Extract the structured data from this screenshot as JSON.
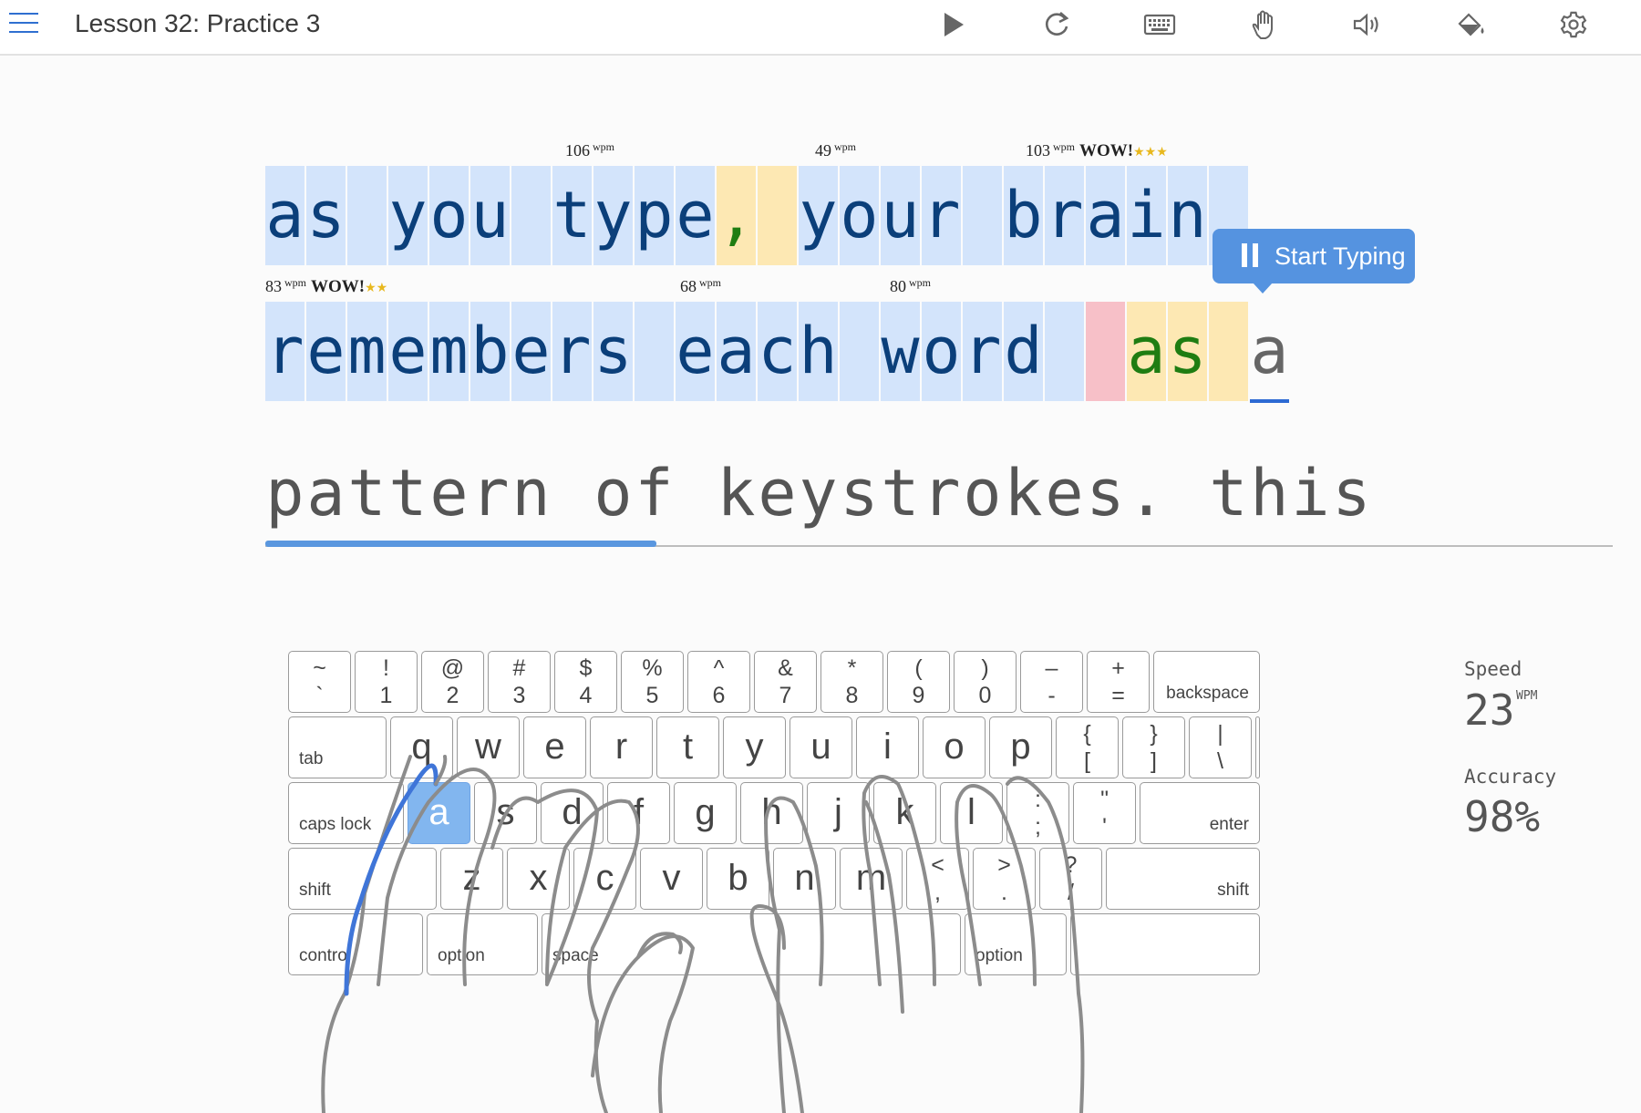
{
  "header": {
    "title": "Lesson 32: Practice 3",
    "tools": [
      "play-icon",
      "restart-icon",
      "keyboard-icon",
      "hand-icon",
      "sound-icon",
      "paint-bucket-icon",
      "gear-icon"
    ]
  },
  "typing": {
    "row1": "as you type, your brain ",
    "row2": "remembers each word as a",
    "row3": "pattern of keystrokes. this",
    "row1_status": "bbbbbbbbbbbyybbbbbbbbbbb",
    "row2_status": "bbbbbbbbbbbbbbbbbbbbppyc",
    "row1_correct_colored": "",
    "word_speeds": [
      {
        "wpm": "106",
        "unit": "wpm",
        "badge": "",
        "stars": ""
      },
      {
        "wpm": "49",
        "unit": "wpm",
        "badge": "",
        "stars": ""
      },
      {
        "wpm": "103",
        "unit": "wpm",
        "badge": "WOW!",
        "stars": "★★★"
      },
      {
        "wpm": "83",
        "unit": "wpm",
        "badge": "WOW!",
        "stars": "★★"
      },
      {
        "wpm": "68",
        "unit": "wpm",
        "badge": "",
        "stars": ""
      },
      {
        "wpm": "80",
        "unit": "wpm",
        "badge": "",
        "stars": ""
      }
    ],
    "lesson_progress": 0.29,
    "tooltip": "Start Typing"
  },
  "keyboard": {
    "number_row": [
      {
        "up": "~",
        "dn": "`"
      },
      {
        "up": "!",
        "dn": "1"
      },
      {
        "up": "@",
        "dn": "2"
      },
      {
        "up": "#",
        "dn": "3"
      },
      {
        "up": "$",
        "dn": "4"
      },
      {
        "up": "%",
        "dn": "5"
      },
      {
        "up": "^",
        "dn": "6"
      },
      {
        "up": "&",
        "dn": "7"
      },
      {
        "up": "*",
        "dn": "8"
      },
      {
        "up": "(",
        "dn": "9"
      },
      {
        "up": ")",
        "dn": "0"
      },
      {
        "up": "–",
        "dn": "-"
      },
      {
        "up": "+",
        "dn": "="
      }
    ],
    "backspace": "backspace",
    "tab": "tab",
    "top_row": [
      "q",
      "w",
      "e",
      "r",
      "t",
      "y",
      "u",
      "i",
      "o",
      "p"
    ],
    "top_row_sym": [
      {
        "up": "{",
        "dn": "["
      },
      {
        "up": "}",
        "dn": "]"
      },
      {
        "up": "|",
        "dn": "\\"
      }
    ],
    "caps_lock": "caps lock",
    "home_row": [
      "a",
      "s",
      "d",
      "f",
      "g",
      "h",
      "j",
      "k",
      "l"
    ],
    "home_row_sym": [
      {
        "up": ":",
        "dn": ";"
      },
      {
        "up": "\"",
        "dn": "'"
      }
    ],
    "enter": "enter",
    "shift_left": "shift",
    "bottom_row": [
      "z",
      "x",
      "c",
      "v",
      "b",
      "n",
      "m"
    ],
    "bottom_row_sym": [
      {
        "up": "<",
        "dn": ","
      },
      {
        "up": ">",
        "dn": "."
      },
      {
        "up": "?",
        "dn": "/"
      }
    ],
    "shift_right": "shift",
    "control": "control",
    "option_left": "option",
    "space": "space",
    "option_right": "option",
    "active_key": "a"
  },
  "stats": {
    "speed_label": "Speed",
    "speed_value": "23",
    "speed_unit": "WPM",
    "accuracy_label": "Accuracy",
    "accuracy_value": "98%"
  },
  "colors": {
    "correct_bg": "#d3e4fb",
    "corrected_bg": "#fde8b3",
    "error_bg": "#f7c0c8",
    "accent": "#5593e0"
  }
}
